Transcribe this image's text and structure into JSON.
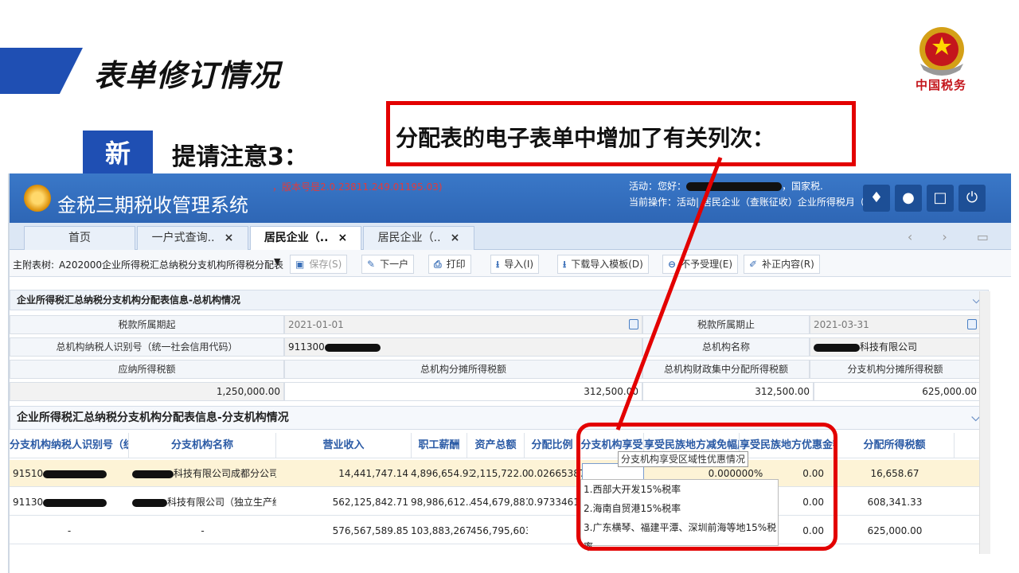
{
  "slide": {
    "title": "表单修订情况",
    "badge": "新",
    "notice": "提请注意3：",
    "callout": "分配表的电子表单中增加了有关列次：",
    "emblem_text": "中国税务"
  },
  "app": {
    "name": "金税三期税收管理系统",
    "version": "，版本号是2.0.23811.249.01195.03)",
    "user_line1_prefix": "活动：您好：",
    "user_line1_suffix": "，国家税.",
    "user_line2": "当前操作：活动| 居民企业（查账征收）企业所得税月（..",
    "header_icons": [
      "bell-icon",
      "users-icon",
      "chat-icon",
      "power-icon"
    ]
  },
  "tabs": [
    {
      "label": "首页",
      "closable": false,
      "active": false
    },
    {
      "label": "一户式查询..",
      "closable": true,
      "active": false
    },
    {
      "label": "居民企业（..",
      "closable": true,
      "active": true
    },
    {
      "label": "居民企业（..",
      "closable": true,
      "active": false
    }
  ],
  "toolbar": {
    "label": "主附表树:",
    "selected_form": "A202000企业所得税汇总纳税分支机构所得税分配表",
    "buttons": {
      "save": "保存(S)",
      "next": "下一户",
      "print": "打印",
      "import": "导入(I)",
      "download_template": "下载导入模板(D)",
      "reject": "不予受理(E)",
      "supplement": "补正内容(R)"
    }
  },
  "hq_section": {
    "title": "企业所得税汇总纳税分支机构分配表信息-总机构情况",
    "period_start_label": "税款所属期起",
    "period_start": "2021-01-01",
    "period_end_label": "税款所属期止",
    "period_end": "2021-03-31",
    "taxpayer_id_label": "总机构纳税人识别号（统一社会信用代码）",
    "taxpayer_id_prefix": "911300",
    "hq_name_label": "总机构名称",
    "hq_name_suffix": "科技有限公司",
    "tax_payable_label": "应纳所得税额",
    "hq_share_label": "总机构分摊所得税额",
    "fiscal_label": "总机构财政集中分配所得税额",
    "branch_share_label": "分支机构分摊所得税额",
    "tax_payable": "1,250,000.00",
    "hq_share": "312,500.00",
    "fiscal": "312,500.00",
    "branch_share": "625,000.00"
  },
  "branch_section": {
    "title": "企业所得税汇总纳税分支机构分配表信息-分支机构情况",
    "columns": [
      "分支机构纳税人识别号（统一",
      "分支机构名称",
      "营业收入",
      "职工薪酬",
      "资产总额",
      "分配比例",
      "分支机构享受",
      "享受民族地方减免幅度",
      "享受民族地方优惠金额",
      "分配所得税额"
    ],
    "rows": [
      {
        "id": "91510",
        "name": "科技有限公司成都分公司",
        "revenue": "14,441,747.14",
        "salary": "4,896,654.93",
        "assets": "2,115,722.03",
        "ratio": "0.02665387.",
        "pref": "",
        "reduction": "0.000000%",
        "pref_amount": "0.00",
        "tax": "16,658.67"
      },
      {
        "id": "91130",
        "name": "科技有限公司（独立生产经...",
        "revenue": "562,125,842.71",
        "salary": "98,986,612....",
        "assets": "454,679,881...",
        "ratio": "0.97334612.",
        "pref": "",
        "reduction": "",
        "pref_amount": "0.00",
        "tax": "608,341.33"
      },
      {
        "id": "-",
        "name": "-",
        "revenue": "576,567,589.85",
        "salary": "103,883,267....",
        "assets": "456,795,603....",
        "ratio": "",
        "pref": "",
        "reduction": "",
        "pref_amount": "0.00",
        "tax": "625,000.00"
      }
    ],
    "tooltip": "分支机构享受区域性优惠情况",
    "dropdown_options": [
      "1.西部大开发15%税率",
      "2.海南自贸港15%税率",
      "3.广东横琴、福建平潭、深圳前海等地15%税率"
    ]
  },
  "colors": {
    "accent": "#1f4fb3",
    "highlight": "#e30000",
    "header": "#2e66b5"
  }
}
